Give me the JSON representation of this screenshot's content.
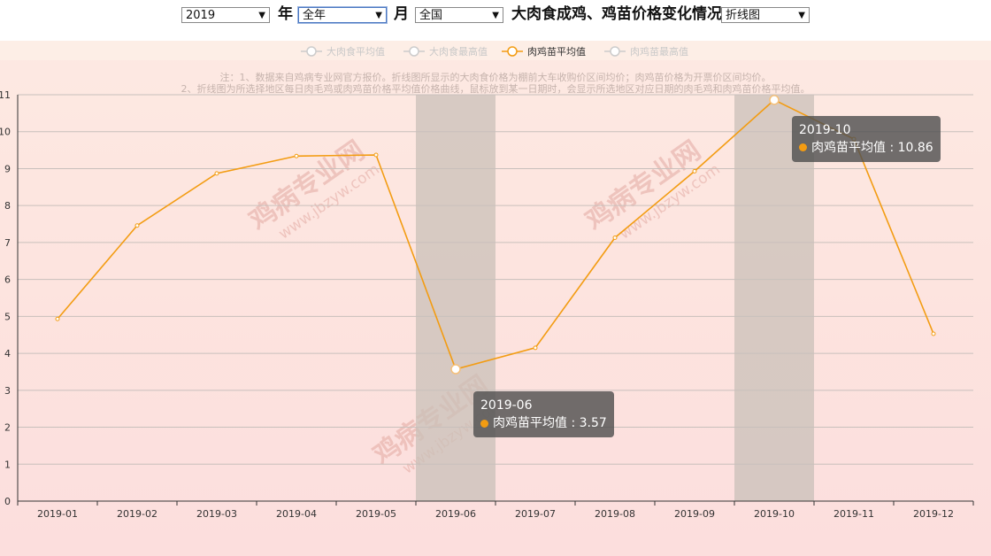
{
  "toolbar": {
    "year_value": "2019",
    "year_label": "年",
    "month_value": "全年",
    "month_label": "月",
    "region_value": "全国",
    "title": "大肉食成鸡、鸡苗价格变化情况",
    "chart_type_value": "折线图"
  },
  "notes": {
    "line1": "注：1、数据来自鸡病专业网官方报价。折线图所显示的大肉食价格为棚前大车收购价区间均价；肉鸡苗价格为开票价区间均价。",
    "line2": "2、折线图为所选择地区每日肉毛鸡或肉鸡苗价格平均值价格曲线，鼠标放到某一日期时，会显示所选地区对应日期的肉毛鸡和肉鸡苗价格平均值。"
  },
  "watermark": {
    "name": "鸡病专业网",
    "url": "www.jbzyw.com",
    "slogan": "为行业尽己任"
  },
  "colors": {
    "line": "#f39c12",
    "legend_inactive": "#cccccc",
    "highlight_band": "#c9c0b8"
  },
  "chart_data": {
    "type": "line",
    "categories": [
      "2019-01",
      "2019-02",
      "2019-03",
      "2019-04",
      "2019-05",
      "2019-06",
      "2019-07",
      "2019-08",
      "2019-09",
      "2019-10",
      "2019-11",
      "2019-12"
    ],
    "legend": [
      {
        "name": "大肉食平均值",
        "active": false
      },
      {
        "name": "大肉食最高值",
        "active": false
      },
      {
        "name": "肉鸡苗平均值",
        "active": true
      },
      {
        "name": "肉鸡苗最高值",
        "active": false
      }
    ],
    "series": [
      {
        "name": "肉鸡苗平均值",
        "values": [
          4.93,
          7.46,
          8.87,
          9.34,
          9.37,
          3.57,
          4.15,
          7.13,
          8.93,
          10.86,
          9.8,
          4.53
        ]
      }
    ],
    "ylim": [
      0,
      11
    ],
    "yticks": [
      "0",
      "1",
      "2",
      "3",
      "4",
      "5",
      "6",
      "7",
      "8",
      "9",
      "10",
      "11"
    ],
    "grid": true,
    "legend_position": "top-center",
    "highlighted_categories": [
      "2019-06",
      "2019-10"
    ],
    "tooltips": [
      {
        "date": "2019-06",
        "series": "肉鸡苗平均值",
        "value": "3.57"
      },
      {
        "date": "2019-10",
        "series": "肉鸡苗平均值",
        "value": "10.86"
      }
    ]
  }
}
